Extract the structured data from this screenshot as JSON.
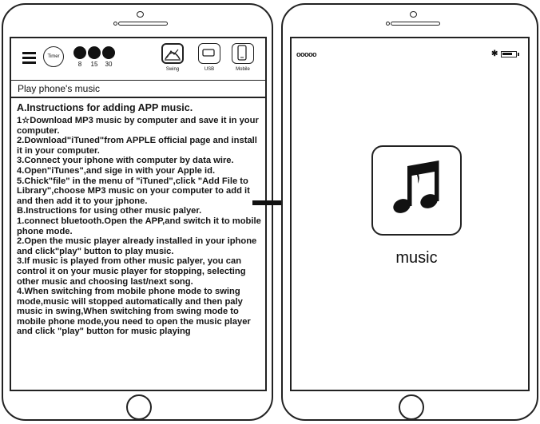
{
  "toolbar": {
    "timer_label": "Timer",
    "timers": [
      "8",
      "15",
      "30"
    ],
    "modes": [
      {
        "label": "Swing",
        "icon": "swing-icon"
      },
      {
        "label": "USB",
        "icon": "usb-icon"
      },
      {
        "label": "Mobile",
        "icon": "mobile-icon"
      }
    ]
  },
  "screen_title": "Play phone's music",
  "instructions": {
    "heading": "A.Instructions for adding APP music.",
    "lines": [
      "1☆Download MP3 music by computer and save it in your computer.",
      "2.Download\"iTuned\"from APPLE official page and install it in your computer.",
      "3.Connect your iphone with computer by data wire.",
      "4.Open\"iTunes\",and sige in with your Apple id.",
      "5.Chick\"file\" in the menu of \"iTuned\",click \"Add File to Library\",choose MP3 music on your computer to add it and then add it to your jphone.",
      "B.Instructions for using other music palyer.",
      "1.connect bluetooth.Open the APP,and switch it to mobile phone mode.",
      "2.Open the music player already installed in your iphone and click\"play\" button to play music.",
      "3.If music is played from other music palyer, you can control it on your music player for stopping, selecting other music and choosing last/next song.",
      "4.When switching from mobile phone mode to swing mode,music will stopped automatically and then paly music in swing,When switching from swing mode to mobile phone mode,you need to open the music player and click \"play\" button for music playing"
    ]
  },
  "status_bar": {
    "signal": "ooooo",
    "bluetooth": "✱"
  },
  "music_app": {
    "label": "music",
    "icon": "music-note-icon"
  },
  "colors": {
    "line": "#222222",
    "background": "#ffffff"
  }
}
